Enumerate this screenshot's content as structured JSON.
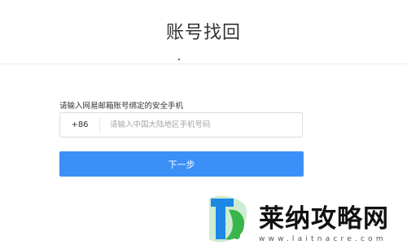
{
  "header": {
    "title": "账号找回"
  },
  "form": {
    "label": "请输入网易邮箱账号绑定的安全手机",
    "country_code": "+86",
    "phone_placeholder": "请输入中国大陆地区手机号码",
    "phone_value": "",
    "next_label": "下一步"
  },
  "watermark": {
    "brand": "莱纳攻略网",
    "url": "www.laitnacre.com",
    "logo_icon": "leaf-logo-icon",
    "colors": {
      "green": "#39b54a",
      "blue": "#1e88e5"
    }
  },
  "colors": {
    "accent": "#3b8ff7"
  }
}
